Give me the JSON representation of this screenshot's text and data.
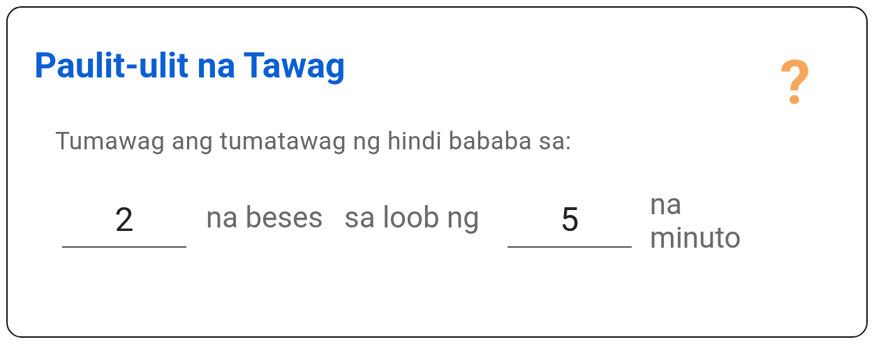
{
  "title": "Paulit-ulit na Tawag",
  "help_icon": "?",
  "description": "Tumawag ang tumatawag ng hindi bababa sa:",
  "times_field": {
    "value": "2"
  },
  "times_label": "na beses",
  "within_label": "sa loob ng",
  "minutes_field": {
    "value": "5"
  },
  "minutes_label": "na minuto"
}
